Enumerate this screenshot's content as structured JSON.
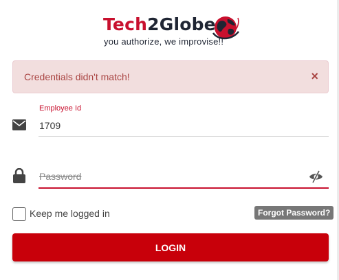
{
  "logo": {
    "part1": "Tech",
    "part2": "2",
    "part3": "Globe",
    "tagline": "you authorize, we improvise!!",
    "brand_red": "#c8102e",
    "brand_dark": "#1f2533"
  },
  "alert": {
    "message": "Credentials didn't match!",
    "close": "×",
    "bg_color": "#f2dede",
    "text_color": "#a94442"
  },
  "employee": {
    "label": "Employee Id",
    "value": "1709",
    "icon": "envelope-icon"
  },
  "password": {
    "placeholder": "Password",
    "value": "",
    "icon": "lock-icon",
    "toggle_icon": "eye-slash-icon"
  },
  "remember": {
    "label": "Keep me logged in",
    "checked": false
  },
  "forgot": {
    "label": "Forgot Password?"
  },
  "login": {
    "label": "LOGIN",
    "color": "#c8000a"
  }
}
